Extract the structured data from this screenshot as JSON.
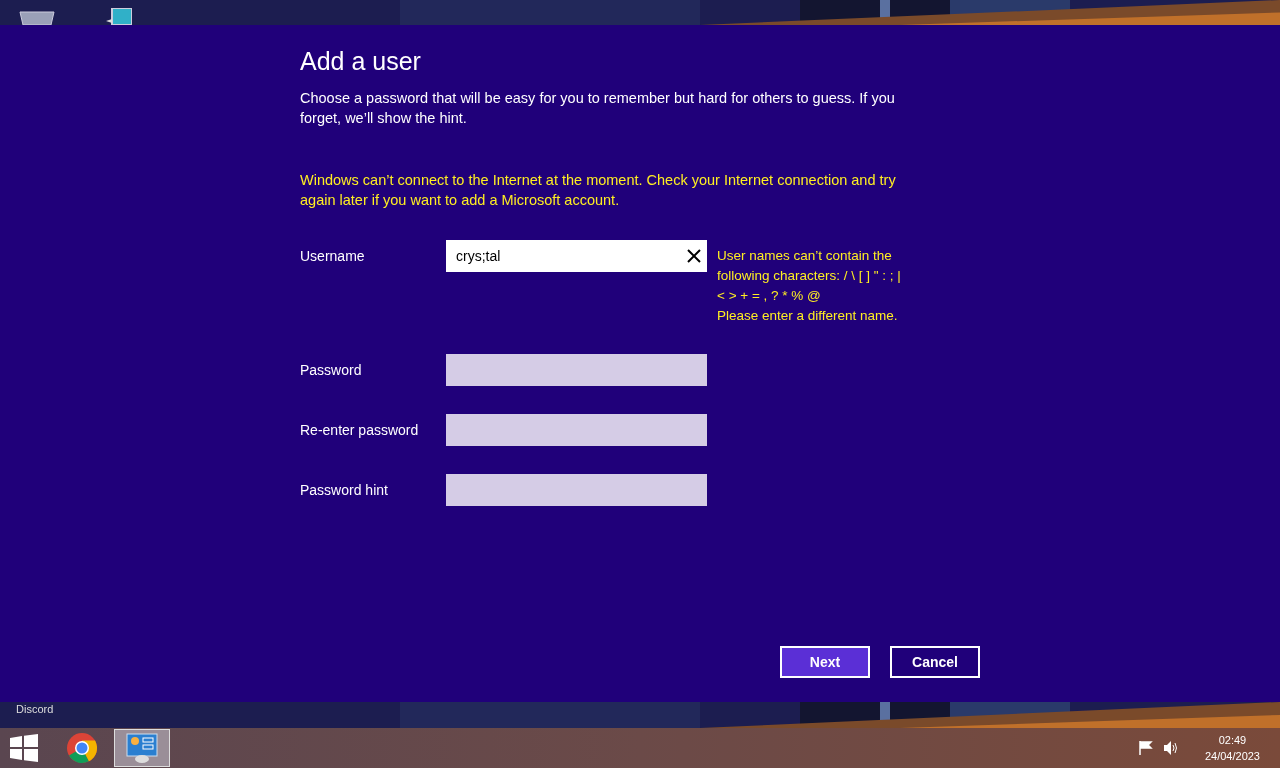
{
  "dialog": {
    "title": "Add a user",
    "intro": "Choose a password that will be easy for you to remember but hard for others to guess. If you forget, we’ll show the hint.",
    "warning": "Windows can’t connect to the Internet at the moment. Check your Internet connection and try again later if you want to add a Microsoft account.",
    "fields": [
      {
        "label": "Username",
        "value": "crys;tal",
        "focused": true,
        "error": [
          "User names can’t contain the",
          "following characters: / \\ [ ] \" : ; |",
          "< > + = , ? * % @",
          "Please enter a different name."
        ]
      },
      {
        "label": "Password",
        "focused": false
      },
      {
        "label": "Re-enter password",
        "focused": false
      },
      {
        "label": "Password hint",
        "focused": false
      }
    ],
    "buttons": [
      {
        "label": "Next",
        "selected": true
      },
      {
        "label": "Cancel",
        "selected": false
      }
    ]
  },
  "desktop": {
    "shortcut_label": "Discord"
  },
  "taskbar": {
    "apps": [
      {
        "kind": "chrome",
        "selected": false
      },
      {
        "kind": "control-panel",
        "selected": true
      }
    ],
    "time": "02:49",
    "date": "24/04/2023"
  }
}
